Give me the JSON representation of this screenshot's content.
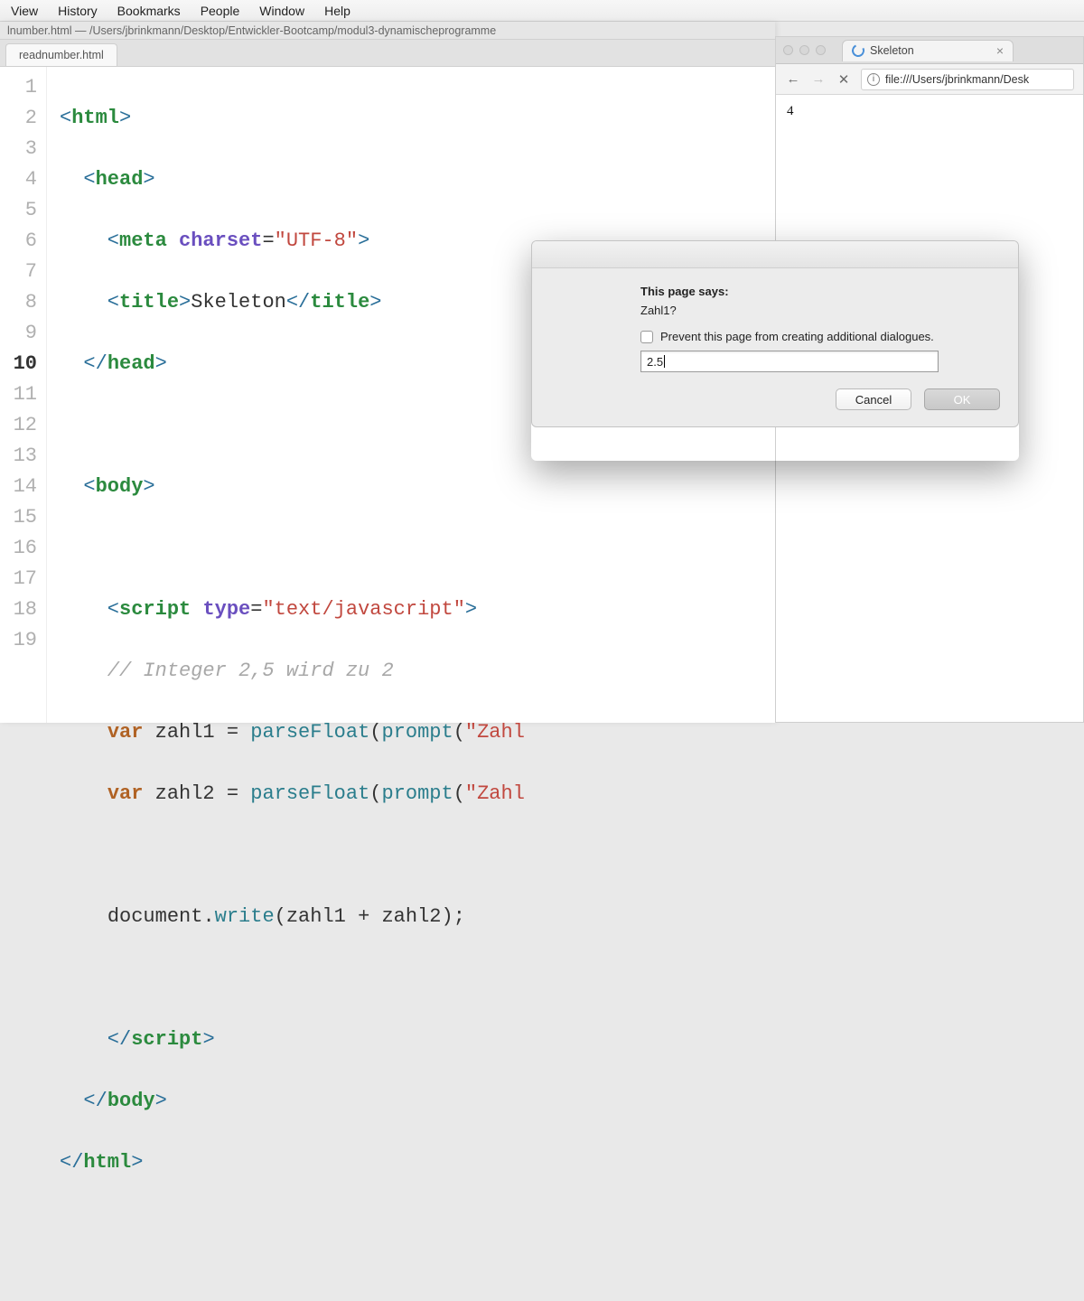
{
  "menubar": {
    "items": [
      "View",
      "History",
      "Bookmarks",
      "People",
      "Window",
      "Help"
    ]
  },
  "editor": {
    "title_path": "lnumber.html — /Users/jbrinkmann/Desktop/Entwickler-Bootcamp/modul3-dynamischeprogramme",
    "tab_label": "readnumber.html",
    "current_line": 10,
    "line_count": 19,
    "lines": {
      "l1": {
        "i0": "<",
        "i1": "html",
        "i2": ">"
      },
      "l2": {
        "i0": "  <",
        "i1": "head",
        "i2": ">"
      },
      "l3": {
        "i0": "    <",
        "i1": "meta",
        "sp": " ",
        "a": "charset",
        "eq": "=",
        "v": "\"UTF-8\"",
        "i2": ">"
      },
      "l4": {
        "i0": "    <",
        "i1": "title",
        "i2": ">",
        "txt": "Skeleton",
        "c0": "</",
        "c1": "title",
        "c2": ">"
      },
      "l5": {
        "i0": "  </",
        "i1": "head",
        "i2": ">"
      },
      "l7": {
        "i0": "  <",
        "i1": "body",
        "i2": ">"
      },
      "l9": {
        "i0": "    <",
        "i1": "script",
        "sp": " ",
        "a": "type",
        "eq": "=",
        "v": "\"text/javascript\"",
        "i2": ">"
      },
      "l10": {
        "c": "    // Integer 2,5 wird zu 2"
      },
      "l11": {
        "pre": "    ",
        "kw": "var",
        "sp": " ",
        "id": "zahl1 = ",
        "fn": "parseFloat",
        "op": "(",
        "fn2": "prompt",
        "op2": "(",
        "s": "\"Zahl"
      },
      "l12": {
        "pre": "    ",
        "kw": "var",
        "sp": " ",
        "id": "zahl2 = ",
        "fn": "parseFloat",
        "op": "(",
        "fn2": "prompt",
        "op2": "(",
        "s": "\"Zahl"
      },
      "l14": {
        "pre": "    ",
        "obj": "document",
        "dot": ".",
        "m": "write",
        "args": "(zahl1 + zahl2);"
      },
      "l16": {
        "i0": "    </",
        "i1": "script",
        "i2": ">"
      },
      "l17": {
        "i0": "  </",
        "i1": "body",
        "i2": ">"
      },
      "l18": {
        "i0": "</",
        "i1": "html",
        "i2": ">"
      }
    }
  },
  "browser": {
    "tab_title": "Skeleton",
    "url": "file:///Users/jbrinkmann/Desk",
    "page_output": "4"
  },
  "dialog": {
    "heading": "This page says:",
    "message": "Zahl1?",
    "checkbox_label": "Prevent this page from creating additional dialogues.",
    "input_value": "2.5",
    "cancel": "Cancel",
    "ok": "OK"
  }
}
